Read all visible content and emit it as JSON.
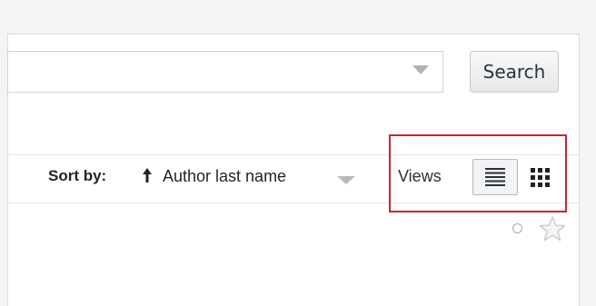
{
  "search": {
    "value": "",
    "placeholder": "",
    "button_label": "Search"
  },
  "sort": {
    "label": "Sort by:",
    "field": "Author last name",
    "direction_icon": "arrow-up-icon"
  },
  "views": {
    "label": "Views",
    "options": [
      "list-view-icon",
      "grid-view-icon"
    ],
    "selected": "list-view-icon",
    "highlight_color": "#d1202f"
  },
  "result_actions": {
    "select_icon": "radio-circle-icon",
    "favorite_icon": "star-icon"
  }
}
